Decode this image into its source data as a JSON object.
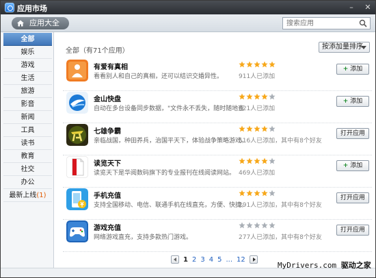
{
  "window": {
    "title": "应用市场"
  },
  "toolbar": {
    "home_label": "应用大全",
    "search_placeholder": "搜索应用"
  },
  "sidebar": {
    "categories": [
      {
        "label": "全部"
      },
      {
        "label": "娱乐"
      },
      {
        "label": "游戏"
      },
      {
        "label": "生活"
      },
      {
        "label": "旅游"
      },
      {
        "label": "影音"
      },
      {
        "label": "新闻"
      },
      {
        "label": "工具"
      },
      {
        "label": "读书"
      },
      {
        "label": "教育"
      },
      {
        "label": "社交"
      },
      {
        "label": "办公"
      }
    ],
    "latest": {
      "label": "最新上线",
      "count": "(1)"
    }
  },
  "main": {
    "heading": "全部（有71个应用）",
    "sort_label": "按添加量排序"
  },
  "apps": [
    {
      "name": "有爱有真相",
      "desc": "看看别人和自己的真相，还可以结识交婚异性。",
      "installs": "911人已添加",
      "rating": 5,
      "button": "添加",
      "action": "add"
    },
    {
      "name": "金山快盘",
      "desc": "自动在多台设备同步数据，\"文件永不丢失，随时随地查",
      "installs": "821人已添加",
      "rating": 4,
      "button": "添加",
      "action": "add"
    },
    {
      "name": "七雄争霸",
      "desc": "亲临战国，种田养兵，治国平天下，体验战争策略游戏。",
      "installs": "516人已添加，其中有8个好友",
      "rating": 4,
      "button": "打开应用",
      "action": "open"
    },
    {
      "name": "读览天下",
      "desc": "读览天下是华阅数码旗下的专业报刊在线阅读网站。",
      "installs": "469人已添加",
      "rating": 4,
      "button": "添加",
      "action": "add"
    },
    {
      "name": "手机充值",
      "desc": "支持全国移动、电信、联通手机在线直充，方便、快捷。",
      "installs": "291人已添加，其中有8个好友",
      "rating": 4,
      "button": "打开应用",
      "action": "open"
    },
    {
      "name": "游戏充值",
      "desc": "网络游戏直充，支持多款热门游戏。",
      "installs": "277人已添加，其中有8个好友",
      "rating": 0,
      "button": "打开应用",
      "action": "open"
    }
  ],
  "pagination": {
    "pages": [
      "1",
      "2",
      "3",
      "4",
      "5"
    ],
    "ellipsis": "...",
    "last": "12",
    "current": "1"
  },
  "watermark": {
    "prefix": "MyDrivers.com",
    "suffix": "驱动之家"
  },
  "colors": {
    "star_on": "#f7a81b",
    "star_off": "#a9afb6",
    "accent": "#3f75b8"
  }
}
